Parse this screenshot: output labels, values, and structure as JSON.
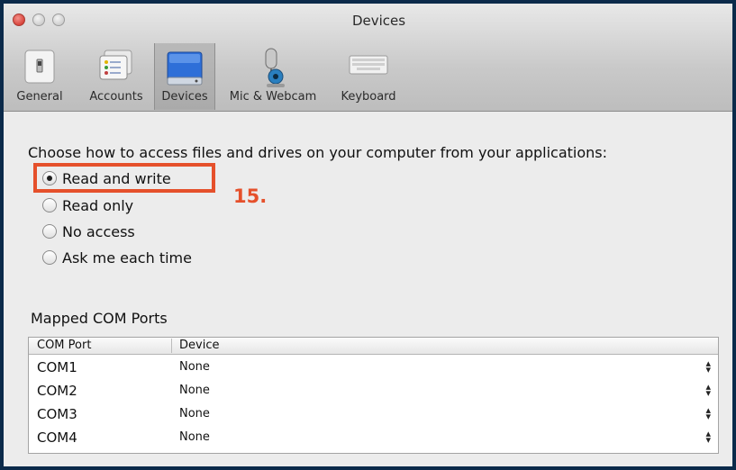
{
  "window": {
    "title": "Devices"
  },
  "toolbar": {
    "items": [
      {
        "label": "General",
        "icon": "switch-icon"
      },
      {
        "label": "Accounts",
        "icon": "accounts-icon"
      },
      {
        "label": "Devices",
        "icon": "hard-drive-icon",
        "selected": true
      },
      {
        "label": "Mic & Webcam",
        "icon": "microphone-webcam-icon"
      },
      {
        "label": "Keyboard",
        "icon": "keyboard-icon"
      }
    ]
  },
  "access": {
    "prompt": "Choose how to access files and drives on your computer from your applications:",
    "options": [
      {
        "label": "Read and write",
        "checked": true
      },
      {
        "label": "Read only",
        "checked": false
      },
      {
        "label": "No access",
        "checked": false
      },
      {
        "label": "Ask me each time",
        "checked": false
      }
    ]
  },
  "annotation": {
    "step": "15.",
    "color": "#e5502b"
  },
  "com_ports": {
    "title": "Mapped COM Ports",
    "headers": [
      "COM Port",
      "Device"
    ],
    "rows": [
      {
        "port": "COM1",
        "device": "None"
      },
      {
        "port": "COM2",
        "device": "None"
      },
      {
        "port": "COM3",
        "device": "None"
      },
      {
        "port": "COM4",
        "device": "None"
      }
    ]
  },
  "colors": {
    "frame": "#0b2a4a",
    "accent": "#e5502b"
  }
}
